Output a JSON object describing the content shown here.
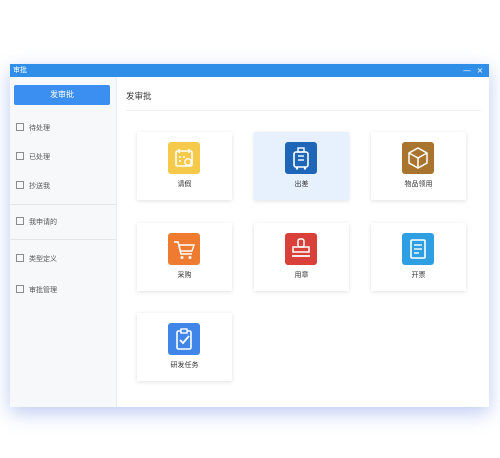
{
  "window": {
    "title": "审批",
    "minimize_glyph": "—",
    "close_glyph": "×"
  },
  "sidebar": {
    "primary_button": "发审批",
    "items": [
      {
        "label": "待处理",
        "icon": "checkbox-icon"
      },
      {
        "label": "已处理",
        "icon": "checkbox-icon"
      },
      {
        "label": "抄送我",
        "icon": "checkbox-icon"
      },
      {
        "label": "我申请的",
        "icon": "checkbox-icon"
      },
      {
        "label": "类型定义",
        "icon": "checkbox-icon"
      },
      {
        "label": "审批管理",
        "icon": "checkbox-icon"
      }
    ]
  },
  "main": {
    "title": "发审批",
    "cards": [
      {
        "label": "请假",
        "icon": "calendar-icon",
        "color": "#f5c94a"
      },
      {
        "label": "出差",
        "icon": "suitcase-icon",
        "color": "#1e66b8",
        "active": true
      },
      {
        "label": "物品领用",
        "icon": "box-icon",
        "color": "#a8742e"
      },
      {
        "label": "采购",
        "icon": "cart-icon",
        "color": "#ef7b31"
      },
      {
        "label": "用章",
        "icon": "stamp-icon",
        "color": "#d9403a"
      },
      {
        "label": "开票",
        "icon": "invoice-icon",
        "color": "#2f9fe3"
      },
      {
        "label": "研发任务",
        "icon": "task-icon",
        "color": "#3f86e8"
      }
    ]
  }
}
